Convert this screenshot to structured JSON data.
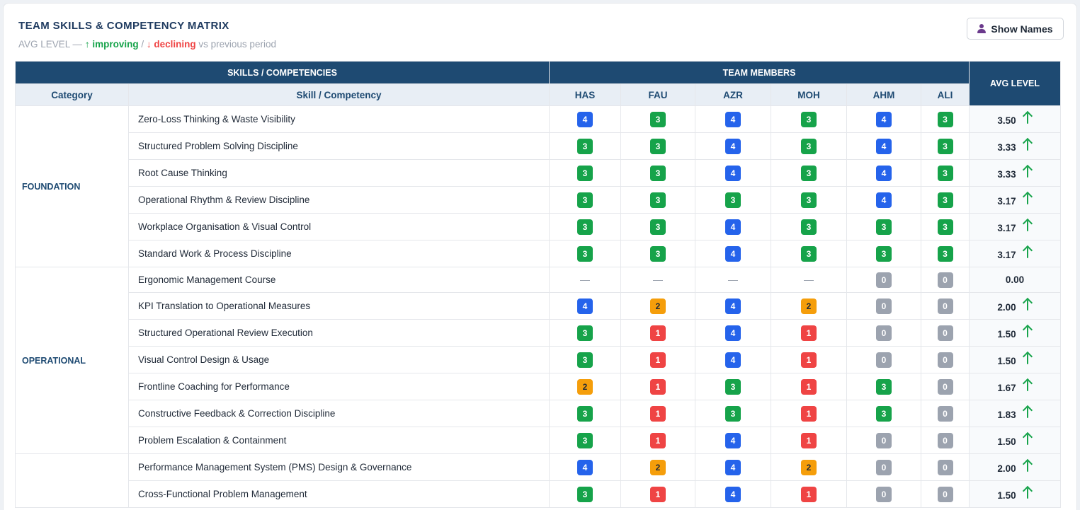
{
  "header": {
    "title": "TEAM SKILLS & COMPETENCY MATRIX",
    "subtitle_prefix": "AVG LEVEL —",
    "improving_label": "↑ improving",
    "separator": "/",
    "declining_label": "↓ declining",
    "subtitle_suffix": "vs previous period",
    "show_names_label": "Show Names"
  },
  "table": {
    "group_skills": "SKILLS / COMPETENCIES",
    "group_members": "TEAM MEMBERS",
    "avg_header": "AVG LEVEL",
    "col_category": "Category",
    "col_skill": "Skill / Competency",
    "members": [
      "HAS",
      "FAU",
      "AZR",
      "MOH",
      "AHM",
      "ALI"
    ],
    "categories": [
      {
        "name": "FOUNDATION",
        "rows": [
          {
            "skill": "Zero-Loss Thinking & Waste Visibility",
            "levels": [
              4,
              3,
              4,
              3,
              4,
              3
            ],
            "avg": "3.50",
            "trend": "up"
          },
          {
            "skill": "Structured Problem Solving Discipline",
            "levels": [
              3,
              3,
              4,
              3,
              4,
              3
            ],
            "avg": "3.33",
            "trend": "up"
          },
          {
            "skill": "Root Cause Thinking",
            "levels": [
              3,
              3,
              4,
              3,
              4,
              3
            ],
            "avg": "3.33",
            "trend": "up"
          },
          {
            "skill": "Operational Rhythm & Review Discipline",
            "levels": [
              3,
              3,
              3,
              3,
              4,
              3
            ],
            "avg": "3.17",
            "trend": "up"
          },
          {
            "skill": "Workplace Organisation & Visual Control",
            "levels": [
              3,
              3,
              4,
              3,
              3,
              3
            ],
            "avg": "3.17",
            "trend": "up"
          },
          {
            "skill": "Standard Work & Process Discipline",
            "levels": [
              3,
              3,
              4,
              3,
              3,
              3
            ],
            "avg": "3.17",
            "trend": "up"
          }
        ]
      },
      {
        "name": "OPERATIONAL",
        "rows": [
          {
            "skill": "Ergonomic Management Course",
            "levels": [
              null,
              null,
              null,
              null,
              0,
              0
            ],
            "avg": "0.00",
            "trend": "none"
          },
          {
            "skill": "KPI Translation to Operational Measures",
            "levels": [
              4,
              2,
              4,
              2,
              0,
              0
            ],
            "avg": "2.00",
            "trend": "up"
          },
          {
            "skill": "Structured Operational Review Execution",
            "levels": [
              3,
              1,
              4,
              1,
              0,
              0
            ],
            "avg": "1.50",
            "trend": "up"
          },
          {
            "skill": "Visual Control Design & Usage",
            "levels": [
              3,
              1,
              4,
              1,
              0,
              0
            ],
            "avg": "1.50",
            "trend": "up"
          },
          {
            "skill": "Frontline Coaching for Performance",
            "levels": [
              2,
              1,
              3,
              1,
              3,
              0
            ],
            "avg": "1.67",
            "trend": "up"
          },
          {
            "skill": "Constructive Feedback & Correction Discipline",
            "levels": [
              3,
              1,
              3,
              1,
              3,
              0
            ],
            "avg": "1.83",
            "trend": "up"
          },
          {
            "skill": "Problem Escalation & Containment",
            "levels": [
              3,
              1,
              4,
              1,
              0,
              0
            ],
            "avg": "1.50",
            "trend": "up"
          }
        ]
      },
      {
        "name": "",
        "rows": [
          {
            "skill": "Performance Management System (PMS) Design & Governance",
            "levels": [
              4,
              2,
              4,
              2,
              0,
              0
            ],
            "avg": "2.00",
            "trend": "up"
          },
          {
            "skill": "Cross-Functional Problem Management",
            "levels": [
              3,
              1,
              4,
              1,
              0,
              0
            ],
            "avg": "1.50",
            "trend": "up"
          }
        ]
      }
    ]
  },
  "level_colors": {
    "4": "#2563eb",
    "3": "#16a34a",
    "2": "#f59e0b",
    "1": "#ef4444",
    "0": "#9ca3af"
  }
}
